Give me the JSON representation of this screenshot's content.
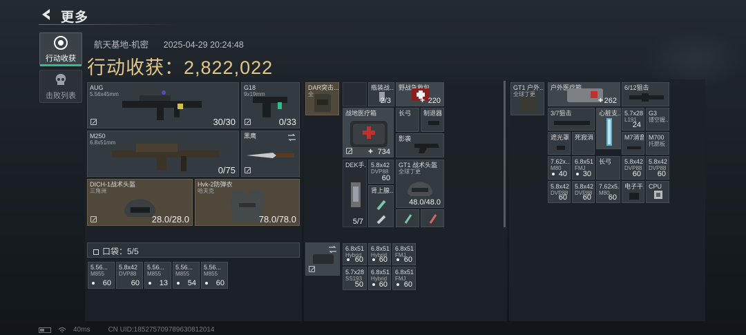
{
  "header": {
    "title": "更多"
  },
  "sidebar": {
    "tabs": [
      {
        "label": "行动收获",
        "icon": "loot-icon",
        "active": true
      },
      {
        "label": "击败列表",
        "icon": "skull-icon",
        "active": false
      }
    ]
  },
  "meta": {
    "map": "航天基地-机密",
    "datetime": "2025-04-29 20:24:48"
  },
  "harvest": {
    "label": "行动收获：",
    "value": "2,822,022"
  },
  "colors": {
    "accent": "#2fbf8e",
    "gold": "#e2c58a"
  },
  "equipment": {
    "primary": {
      "name": "AUG",
      "ammo": "5.56x45mm",
      "count": "30/30"
    },
    "pistol": {
      "name": "G18",
      "ammo": "9x19mm",
      "count": "0/33"
    },
    "secondary": {
      "name": "M250",
      "ammo": "6.8x51mm",
      "count": "0/75"
    },
    "melee": {
      "name": "黑鹰"
    },
    "helmet": {
      "name": "DICH-1战术头盔",
      "sub": "三角洲",
      "count": "28.0/28.0"
    },
    "armor": {
      "name": "Hvk-2防弹衣",
      "sub": "哈夫克",
      "count": "78.0/78.0"
    }
  },
  "pocket": {
    "label": "口袋：5/5",
    "items": [
      {
        "l1": "5.56...",
        "l2": "M855",
        "count": "60"
      },
      {
        "l1": "5.8x42",
        "l2": "DVP88",
        "count": "60"
      },
      {
        "l1": "5.56...",
        "l2": "M855",
        "count": "13"
      },
      {
        "l1": "5.56...",
        "l2": "M855",
        "count": "54"
      },
      {
        "l1": "5.56...",
        "l2": "M855",
        "count": "60"
      }
    ]
  },
  "rig": {
    "name": "DAR突击...",
    "sub": "全",
    "items": {
      "armor_case": {
        "name": "瓶装战...",
        "count": "2/3"
      },
      "first_aid": {
        "name": "野战急救包",
        "count": "220"
      },
      "med_kit": {
        "name": "战地医疗箱",
        "count": "734"
      },
      "longbow": {
        "name": "长弓"
      },
      "tube": {
        "name": "制退器"
      },
      "shadow": {
        "name": "影袭"
      },
      "dek": {
        "name": "DEK手...",
        "count": "5/7"
      },
      "dvp": {
        "l1": "5.8x42",
        "l2": "DVP88",
        "count": "60"
      },
      "syringe": {
        "name": "肾上腺..."
      },
      "gt1": {
        "name": "GT1 战术头盔",
        "sub": "全球丁更",
        "count": "48.0/48.0"
      }
    }
  },
  "bag_ammo": [
    {
      "l1": "6.8x51",
      "l2": "Hybrid",
      "count": "60"
    },
    {
      "l1": "6.8x51",
      "l2": "Hybrid",
      "count": "60"
    },
    {
      "l1": "6.8x51",
      "l2": "FMJ",
      "count": "60"
    },
    {
      "l1": "5.7x28",
      "l2": "SS193",
      "count": "50"
    },
    {
      "l1": "6.8x51",
      "l2": "Hybrid",
      "count": "60"
    },
    {
      "l1": "6.8x51",
      "l2": "FMJ",
      "count": "60"
    }
  ],
  "backpack": {
    "name": "GT1 户外...",
    "sub": "全球丁更",
    "items": {
      "medbag": {
        "name": "户外医疗箱",
        "count": "262"
      },
      "scope612": {
        "name": "6/12狙击"
      },
      "scope37": {
        "name": "3/7狙击"
      },
      "heart": {
        "name": "心脏支..."
      },
      "ammo57": {
        "l1": "5.7x28",
        "l2": "L191",
        "count": "24"
      },
      "g3": {
        "l1": "G3",
        "l2": "镂空握..."
      },
      "flash": {
        "name": "遮光罩"
      },
      "silencer": {
        "name": "死寂消..."
      },
      "m7": {
        "name": "M7消音"
      },
      "m700": {
        "l1": "M700",
        "l2": "托腮板"
      },
      "r1": [
        {
          "l1": "7.62x...",
          "l2": "M80",
          "count": "40"
        },
        {
          "l1": "6.8x51",
          "l2": "FMJ",
          "count": "30"
        },
        {
          "l1": "长弓",
          "l2": "",
          "count": ""
        },
        {
          "l1": "5.8x42",
          "l2": "DVP88",
          "count": "60"
        },
        {
          "l1": "5.8x42",
          "l2": "DVP88",
          "count": "60"
        }
      ],
      "r2": [
        {
          "l1": "5.8x42",
          "l2": "DVP88",
          "count": "60"
        },
        {
          "l1": "5.8x42",
          "l2": "DVP88",
          "count": "60"
        },
        {
          "l1": "7.62x5...",
          "l2": "M80",
          "count": "60"
        },
        {
          "l1": "电子干...",
          "l2": "",
          "count": ""
        },
        {
          "l1": "CPU",
          "l2": "",
          "count": ""
        }
      ]
    }
  },
  "status": {
    "ping": "40ms",
    "uid": "CN UID:1852757097896308120​14"
  }
}
